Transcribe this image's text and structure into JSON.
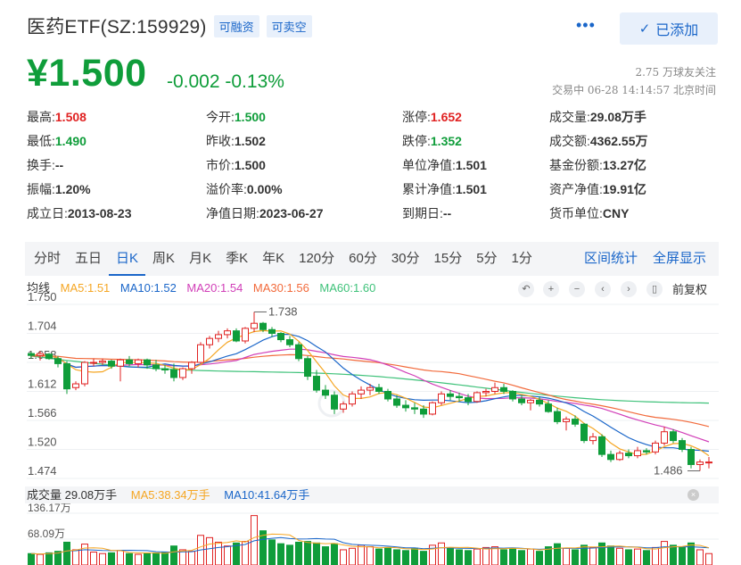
{
  "header": {
    "title": "医药ETF(SZ:159929)",
    "tag_margin": "可融资",
    "tag_short": "可卖空",
    "more": "•••",
    "add_button": "已添加"
  },
  "quote": {
    "price": "¥1.500",
    "change": "-0.002 -0.13%",
    "followers": "2.75 万球友关注",
    "status_time": "交易中 06-28 14:14:57 北京时间"
  },
  "stats": [
    {
      "label": "最高:",
      "value": "1.508",
      "color": "red"
    },
    {
      "label": "今开:",
      "value": "1.500",
      "color": "green"
    },
    {
      "label": "涨停:",
      "value": "1.652",
      "color": "red"
    },
    {
      "label": "成交量:",
      "value": "29.08万手",
      "color": ""
    },
    {
      "label": "最低:",
      "value": "1.490",
      "color": "green"
    },
    {
      "label": "昨收:",
      "value": "1.502",
      "color": ""
    },
    {
      "label": "跌停:",
      "value": "1.352",
      "color": "green"
    },
    {
      "label": "成交额:",
      "value": "4362.55万",
      "color": ""
    },
    {
      "label": "换手:",
      "value": "--",
      "color": ""
    },
    {
      "label": "市价:",
      "value": "1.500",
      "color": ""
    },
    {
      "label": "单位净值:",
      "value": "1.501",
      "color": ""
    },
    {
      "label": "基金份额:",
      "value": "13.27亿",
      "color": ""
    },
    {
      "label": "振幅:",
      "value": "1.20%",
      "color": ""
    },
    {
      "label": "溢价率:",
      "value": "0.00%",
      "color": ""
    },
    {
      "label": "累计净值:",
      "value": "1.501",
      "color": ""
    },
    {
      "label": "资产净值:",
      "value": "19.91亿",
      "color": ""
    },
    {
      "label": "成立日:",
      "value": "2013-08-23",
      "color": ""
    },
    {
      "label": "净值日期:",
      "value": "2023-06-27",
      "color": ""
    },
    {
      "label": "到期日:",
      "value": "--",
      "color": ""
    },
    {
      "label": "货币单位:",
      "value": "CNY",
      "color": ""
    }
  ],
  "tabs": [
    "分时",
    "五日",
    "日K",
    "周K",
    "月K",
    "季K",
    "年K",
    "120分",
    "60分",
    "30分",
    "15分",
    "5分",
    "1分"
  ],
  "active_tab": "日K",
  "tab_right": [
    "区间统计",
    "全屏显示"
  ],
  "ma_legend": {
    "avg": "均线",
    "ma5": "MA5:1.51",
    "ma10": "MA10:1.52",
    "ma20": "MA20:1.54",
    "ma30": "MA30:1.56",
    "ma60": "MA60:1.60"
  },
  "controls": [
    "↶",
    "+",
    "−",
    "‹",
    "›",
    "▯"
  ],
  "fuquan": "前复权",
  "colors": {
    "up": "#e02222",
    "down": "#0f9d3a",
    "ma5": "#f5a623",
    "ma10": "#1a66c9",
    "ma20": "#d13fb8",
    "ma30": "#f26a3b",
    "ma60": "#3fc27a",
    "accent": "#1a66c9"
  },
  "chart_data": {
    "type": "candlestick",
    "y_ticks": [
      "1.750",
      "1.704",
      "1.658",
      "1.612",
      "1.566",
      "1.520",
      "1.474"
    ],
    "ylim": [
      1.474,
      1.75
    ],
    "annotations": {
      "max": "1.738",
      "min": "1.486"
    },
    "ohlc": [
      [
        1.672,
        1.675,
        1.664,
        1.669
      ],
      [
        1.669,
        1.676,
        1.661,
        1.672
      ],
      [
        1.671,
        1.673,
        1.662,
        1.664
      ],
      [
        1.664,
        1.668,
        1.65,
        1.656
      ],
      [
        1.656,
        1.66,
        1.608,
        1.616
      ],
      [
        1.618,
        1.628,
        1.614,
        1.624
      ],
      [
        1.624,
        1.66,
        1.62,
        1.658
      ],
      [
        1.658,
        1.664,
        1.652,
        1.658
      ],
      [
        1.658,
        1.664,
        1.654,
        1.66
      ],
      [
        1.66,
        1.662,
        1.648,
        1.652
      ],
      [
        1.652,
        1.664,
        1.628,
        1.662
      ],
      [
        1.662,
        1.668,
        1.652,
        1.656
      ],
      [
        1.656,
        1.664,
        1.65,
        1.662
      ],
      [
        1.662,
        1.664,
        1.648,
        1.654
      ],
      [
        1.654,
        1.662,
        1.644,
        1.648
      ],
      [
        1.648,
        1.654,
        1.64,
        1.646
      ],
      [
        1.646,
        1.656,
        1.628,
        1.634
      ],
      [
        1.634,
        1.65,
        1.63,
        1.648
      ],
      [
        1.648,
        1.66,
        1.64,
        1.658
      ],
      [
        1.658,
        1.69,
        1.656,
        1.686
      ],
      [
        1.686,
        1.7,
        1.68,
        1.696
      ],
      [
        1.696,
        1.708,
        1.69,
        1.702
      ],
      [
        1.702,
        1.712,
        1.696,
        1.708
      ],
      [
        1.708,
        1.712,
        1.69,
        1.692
      ],
      [
        1.692,
        1.714,
        1.688,
        1.712
      ],
      [
        1.712,
        1.738,
        1.706,
        1.72
      ],
      [
        1.72,
        1.722,
        1.706,
        1.71
      ],
      [
        1.71,
        1.714,
        1.698,
        1.704
      ],
      [
        1.704,
        1.706,
        1.69,
        1.694
      ],
      [
        1.694,
        1.7,
        1.682,
        1.686
      ],
      [
        1.686,
        1.69,
        1.66,
        1.664
      ],
      [
        1.664,
        1.668,
        1.63,
        1.636
      ],
      [
        1.636,
        1.646,
        1.61,
        1.614
      ],
      [
        1.614,
        1.622,
        1.6,
        1.606
      ],
      [
        1.606,
        1.612,
        1.576,
        1.584
      ],
      [
        1.584,
        1.596,
        1.578,
        1.592
      ],
      [
        1.592,
        1.612,
        1.588,
        1.608
      ],
      [
        1.608,
        1.62,
        1.6,
        1.614
      ],
      [
        1.614,
        1.624,
        1.606,
        1.618
      ],
      [
        1.618,
        1.624,
        1.608,
        1.612
      ],
      [
        1.612,
        1.616,
        1.596,
        1.6
      ],
      [
        1.6,
        1.606,
        1.586,
        1.59
      ],
      [
        1.59,
        1.598,
        1.58,
        1.586
      ],
      [
        1.586,
        1.594,
        1.576,
        1.584
      ],
      [
        1.584,
        1.59,
        1.57,
        1.576
      ],
      [
        1.576,
        1.596,
        1.574,
        1.594
      ],
      [
        1.594,
        1.612,
        1.59,
        1.608
      ],
      [
        1.608,
        1.614,
        1.598,
        1.604
      ],
      [
        1.604,
        1.61,
        1.596,
        1.602
      ],
      [
        1.602,
        1.608,
        1.59,
        1.596
      ],
      [
        1.596,
        1.612,
        1.594,
        1.61
      ],
      [
        1.61,
        1.616,
        1.604,
        1.612
      ],
      [
        1.612,
        1.626,
        1.608,
        1.618
      ],
      [
        1.618,
        1.624,
        1.608,
        1.612
      ],
      [
        1.612,
        1.614,
        1.596,
        1.6
      ],
      [
        1.6,
        1.606,
        1.59,
        1.594
      ],
      [
        1.594,
        1.6,
        1.582,
        1.598
      ],
      [
        1.598,
        1.604,
        1.588,
        1.592
      ],
      [
        1.592,
        1.598,
        1.578,
        1.58
      ],
      [
        1.58,
        1.586,
        1.56,
        1.564
      ],
      [
        1.564,
        1.572,
        1.55,
        1.568
      ],
      [
        1.568,
        1.574,
        1.556,
        1.56
      ],
      [
        1.56,
        1.562,
        1.53,
        1.534
      ],
      [
        1.534,
        1.546,
        1.528,
        1.54
      ],
      [
        1.54,
        1.544,
        1.508,
        1.512
      ],
      [
        1.512,
        1.518,
        1.5,
        1.504
      ],
      [
        1.504,
        1.518,
        1.502,
        1.514
      ],
      [
        1.514,
        1.52,
        1.506,
        1.51
      ],
      [
        1.51,
        1.524,
        1.506,
        1.518
      ],
      [
        1.518,
        1.522,
        1.512,
        1.516
      ],
      [
        1.516,
        1.534,
        1.512,
        1.53
      ],
      [
        1.53,
        1.556,
        1.526,
        1.548
      ],
      [
        1.548,
        1.552,
        1.53,
        1.534
      ],
      [
        1.534,
        1.538,
        1.516,
        1.52
      ],
      [
        1.52,
        1.524,
        1.49,
        1.496
      ],
      [
        1.496,
        1.504,
        1.486,
        1.5
      ],
      [
        1.5,
        1.508,
        1.49,
        1.5
      ]
    ]
  },
  "volume_legend": {
    "vol": "成交量 29.08万手",
    "ma5": "MA5:38.34万手",
    "ma10": "MA10:41.64万手",
    "close": "×"
  },
  "volume_data": {
    "ticks": [
      "136.17万",
      "68.09万"
    ],
    "values": [
      30,
      28,
      32,
      36,
      60,
      40,
      55,
      34,
      30,
      32,
      38,
      30,
      28,
      30,
      32,
      34,
      50,
      40,
      36,
      78,
      72,
      60,
      50,
      58,
      62,
      130,
      90,
      66,
      56,
      52,
      60,
      62,
      58,
      48,
      56,
      40,
      44,
      52,
      48,
      42,
      46,
      40,
      38,
      44,
      36,
      52,
      58,
      44,
      40,
      38,
      42,
      46,
      48,
      40,
      44,
      38,
      42,
      36,
      48,
      56,
      44,
      40,
      52,
      46,
      58,
      50,
      44,
      40,
      42,
      38,
      46,
      62,
      52,
      46,
      58,
      40,
      30
    ]
  }
}
